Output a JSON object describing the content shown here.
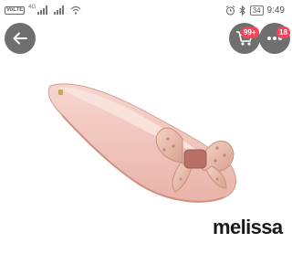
{
  "status_bar": {
    "volte_label": "VoLTE",
    "network_label": "4G",
    "battery_level": "34",
    "time": "9:49",
    "icons": [
      "volte-icon",
      "signal-icon",
      "signal-icon",
      "wifi-icon",
      "alarm-icon",
      "bluetooth-icon",
      "battery-icon"
    ]
  },
  "toolbar": {
    "back_icon": "arrow-left-icon",
    "cart_icon": "shopping-cart-icon",
    "cart_badge": "99+",
    "more_icon": "more-dots-icon",
    "more_badge": "18"
  },
  "product": {
    "image": "pink-jelly-flat-shoe-with-bow",
    "brand": "melissa"
  },
  "colors": {
    "overlay_button": "#6f6f6f",
    "badge": "#f0455b",
    "shoe": "#f2c9c2"
  }
}
